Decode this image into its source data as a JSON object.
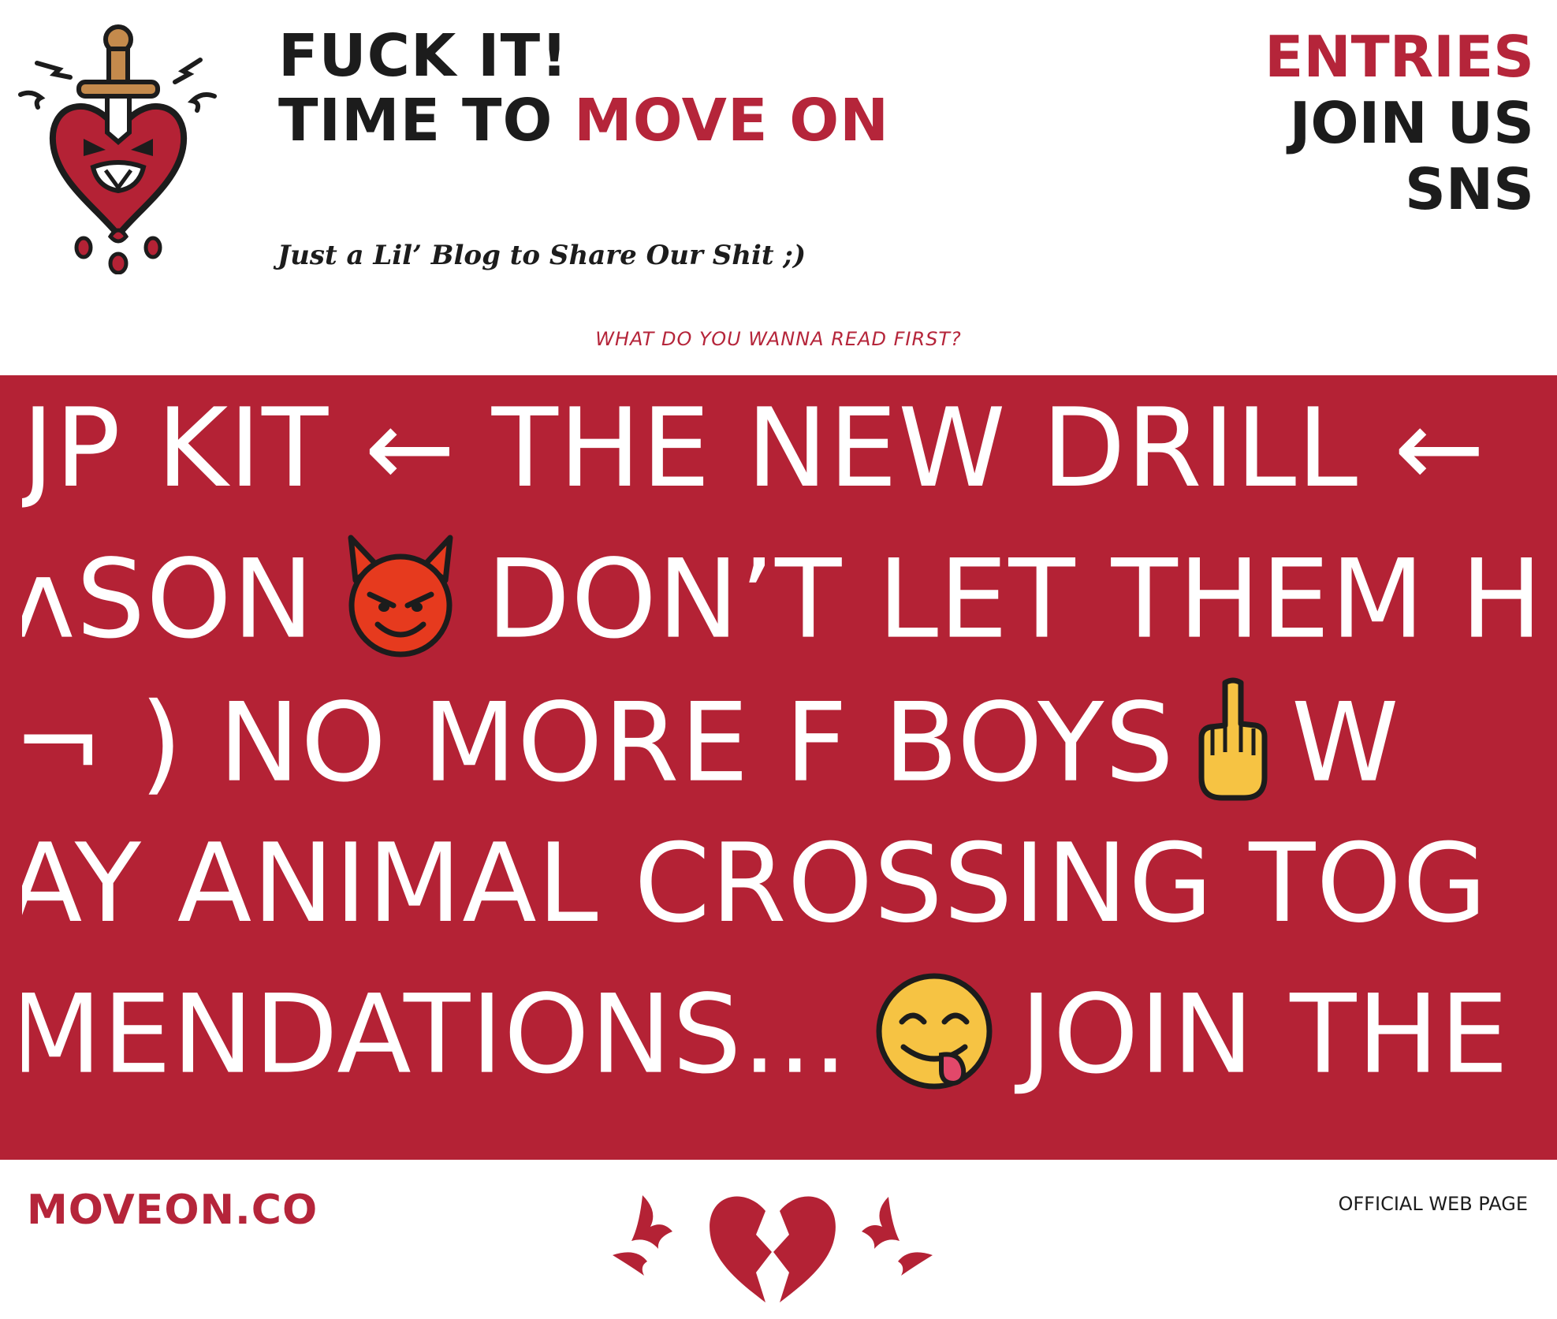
{
  "header": {
    "title_line1": "FUCK IT!",
    "title_line2_prefix": "TIME TO ",
    "title_line2_accent": "MOVE ON",
    "tagline": "Just a Lil’ Blog to Share Our Shit  ;)"
  },
  "nav": {
    "items": [
      {
        "label": "ENTRIES",
        "active": true
      },
      {
        "label": "JOIN US",
        "active": false
      },
      {
        "label": "SNS",
        "active": false
      }
    ]
  },
  "prompt": "WHAT DO YOU WANNA READ FIRST?",
  "ticker": {
    "rows": [
      {
        "before": "JP KIT ← THE NEW DRILL ←",
        "emoji": "",
        "after": ""
      },
      {
        "before": "ʌSON",
        "emoji": "smiling-devil",
        "after": "DON’T LET THEM H"
      },
      {
        "before": "¬ )  NO MORE F BOYS",
        "emoji": "middle-finger",
        "after": "W"
      },
      {
        "before": "AY ANIMAL CROSSING TOG",
        "emoji": "",
        "after": ""
      },
      {
        "before": "MENDATIONS...",
        "emoji": "yum-face",
        "after": "JOIN THE"
      }
    ]
  },
  "footer": {
    "brand": "MOVEON.CO",
    "note": "OFFICIAL WEB PAGE"
  },
  "colors": {
    "accent": "#b5253a",
    "band": "#b42235",
    "text": "#1c1c1c"
  }
}
